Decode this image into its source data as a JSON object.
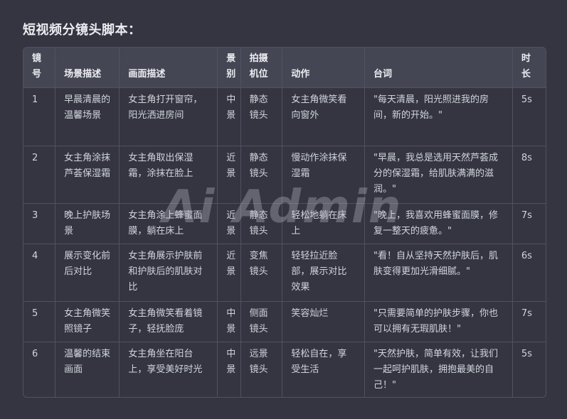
{
  "heading": "短视频分镜头脚本：",
  "table": {
    "headers": [
      "镜号",
      "场景描述",
      "画面描述",
      "景别",
      "拍摄机位",
      "动作",
      "台词",
      "时长"
    ],
    "rows": [
      [
        "1",
        "早晨清晨的温馨场景",
        "女主角打开窗帘，阳光洒进房间",
        "中景",
        "静态镜头",
        "女主角微笑看向窗外",
        "\"每天清晨，阳光照进我的房间，新的开始。\"",
        "5s"
      ],
      [
        "2",
        "女主角涂抹芦荟保湿霜",
        "女主角取出保湿霜，涂抹在脸上",
        "近景",
        "静态镜头",
        "慢动作涂抹保湿霜",
        "\"早晨，我总是选用天然芦荟成分的保湿霜，给肌肤满满的滋润。\"",
        "8s"
      ],
      [
        "3",
        "晚上护肤场景",
        "女主角涂上蜂蜜面膜，躺在床上",
        "近景",
        "静态镜头",
        "轻松地躺在床上",
        "\"晚上，我喜欢用蜂蜜面膜，修复一整天的疲惫。\"",
        "7s"
      ],
      [
        "4",
        "展示变化前后对比",
        "女主角展示护肤前和护肤后的肌肤对比",
        "近景",
        "变焦镜头",
        "轻轻拉近脸部，展示对比效果",
        "\"看！自从坚持天然护肤后，肌肤变得更加光滑细腻。\"",
        "6s"
      ],
      [
        "5",
        "女主角微笑照镜子",
        "女主角微笑看着镜子，轻抚脸庞",
        "中景",
        "侧面镜头",
        "笑容灿烂",
        "\"只需要简单的护肤步骤，你也可以拥有无瑕肌肤！\"",
        "7s"
      ],
      [
        "6",
        "温馨的结束画面",
        "女主角坐在阳台上，享受美好时光",
        "中景",
        "远景镜头",
        "轻松自在，享受生活",
        "\"天然护肤，简单有效，让我们一起呵护肌肤，拥抱最美的自己！\"",
        "5s"
      ]
    ]
  },
  "watermark": "Ai Admin"
}
